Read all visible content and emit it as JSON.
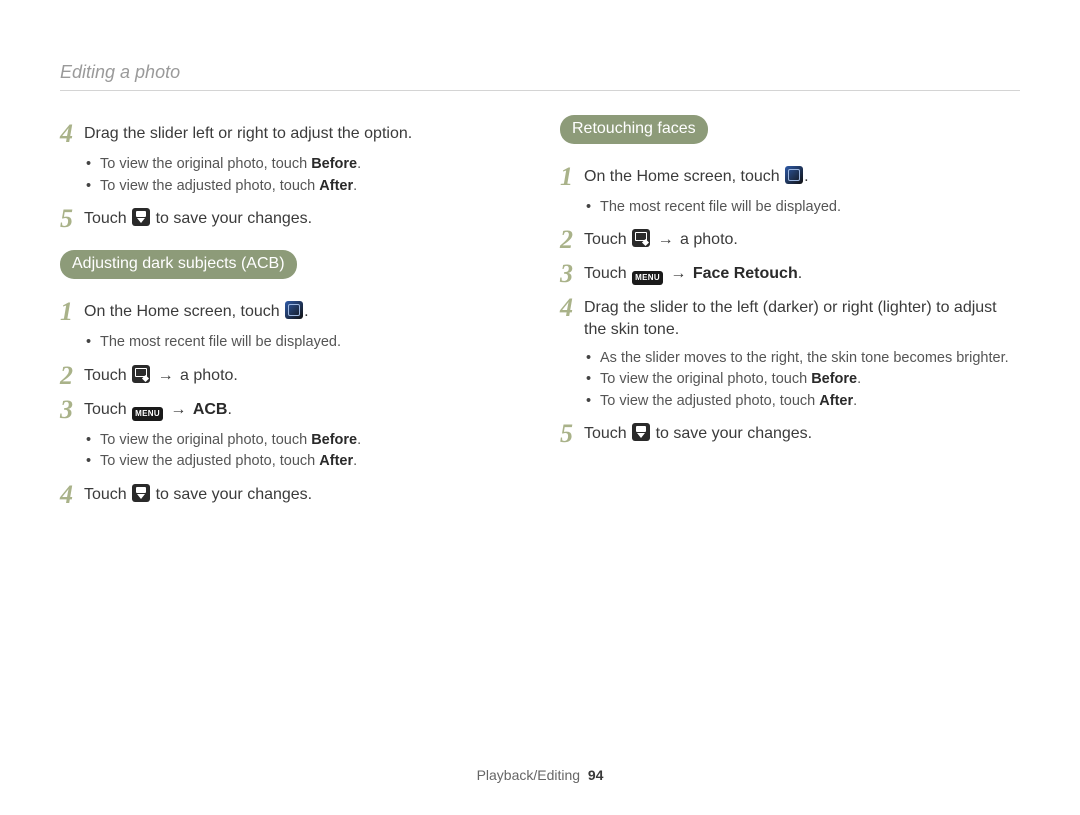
{
  "header": {
    "title": "Editing a photo"
  },
  "footer": {
    "section": "Playback/Editing",
    "page": "94"
  },
  "left": {
    "intro": {
      "s4": {
        "text": "Drag the slider left or right to adjust the option.",
        "b1_pre": "To view the original photo, touch ",
        "b1_bold": "Before",
        "b1_post": ".",
        "b2_pre": "To view the adjusted photo, touch ",
        "b2_bold": "After",
        "b2_post": "."
      },
      "s5": {
        "pre": "Touch ",
        "post": " to save your changes."
      }
    },
    "acb": {
      "pill": "Adjusting dark subjects (ACB)",
      "s1": {
        "pre": "On the Home screen, touch ",
        "post": ".",
        "bullet": "The most recent file will be displayed."
      },
      "s2": {
        "pre": "Touch ",
        "arrow": "→",
        "post": " a photo."
      },
      "s3": {
        "pre": "Touch ",
        "arrow": "→",
        "bold": "ACB",
        "post": ".",
        "b1_pre": "To view the original photo, touch ",
        "b1_bold": "Before",
        "b1_post": ".",
        "b2_pre": "To view the adjusted photo, touch ",
        "b2_bold": "After",
        "b2_post": "."
      },
      "s4": {
        "pre": "Touch ",
        "post": " to save your changes."
      }
    }
  },
  "right": {
    "retouch": {
      "pill": "Retouching faces",
      "s1": {
        "pre": "On the Home screen, touch ",
        "post": ".",
        "bullet": "The most recent file will be displayed."
      },
      "s2": {
        "pre": "Touch ",
        "arrow": "→",
        "post": " a photo."
      },
      "s3": {
        "pre": "Touch ",
        "arrow": "→",
        "bold": "Face Retouch",
        "post": "."
      },
      "s4": {
        "text": "Drag the slider to the left (darker) or right (lighter) to adjust the skin tone.",
        "b1": "As the slider moves to the right, the skin tone becomes brighter.",
        "b2_pre": "To view the original photo, touch ",
        "b2_bold": "Before",
        "b2_post": ".",
        "b3_pre": "To view the adjusted photo, touch ",
        "b3_bold": "After",
        "b3_post": "."
      },
      "s5": {
        "pre": "Touch ",
        "post": " to save your changes."
      }
    }
  },
  "nums": {
    "1": "1",
    "2": "2",
    "3": "3",
    "4": "4",
    "5": "5"
  }
}
